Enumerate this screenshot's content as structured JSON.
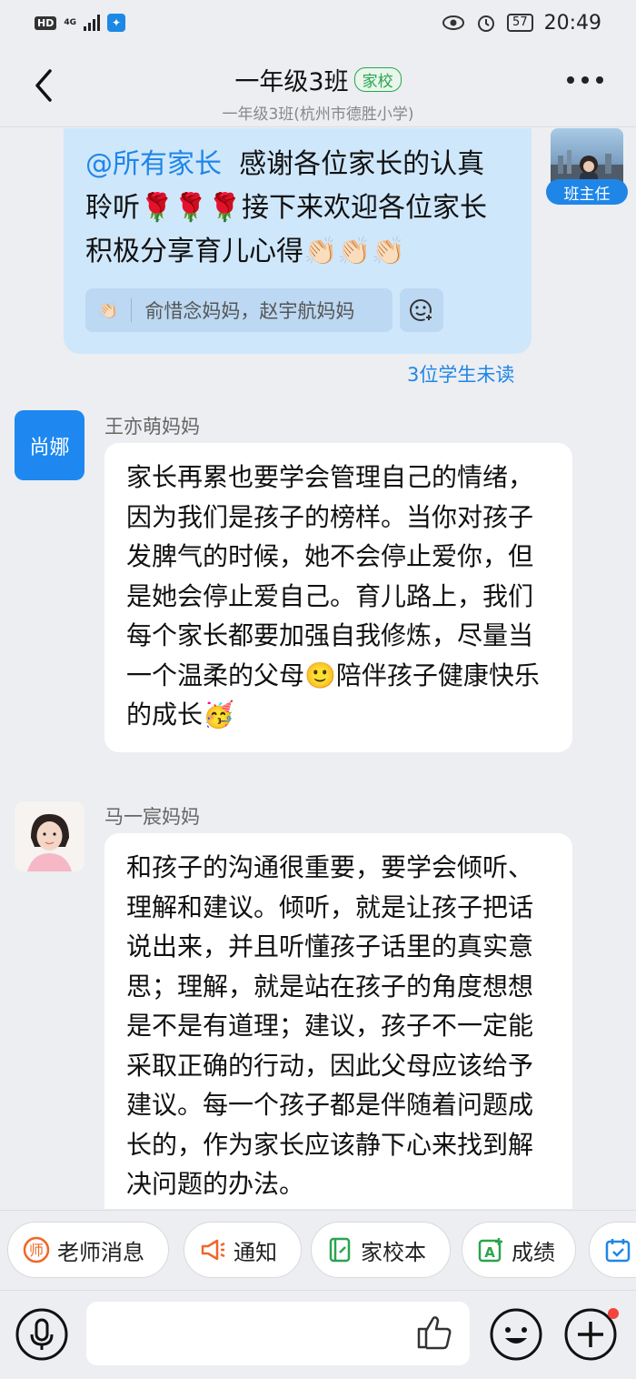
{
  "status_bar": {
    "hd": "HD",
    "network": "4G",
    "battery": "57",
    "time": "20:49"
  },
  "header": {
    "title": "一年级3班",
    "badge": "家校",
    "subtitle": "一年级3班(杭州市德胜小学)"
  },
  "messages": {
    "self": {
      "mention": "@所有家长",
      "text": "感谢各位家长的认真聆听🌹🌹🌹接下来欢迎各位家长积极分享育儿心得👏🏻👏🏻👏🏻",
      "reply_names": "俞惜念妈妈，赵宇航妈妈",
      "unread": "3位学生未读",
      "teacher_tag": "班主任"
    },
    "msg1": {
      "avatar_text": "尚娜",
      "sender": "王亦萌妈妈",
      "text_main": "家长再累也要学会管理自己的情绪，因为我们是孩子的榜样。当你对孩子发脾气的时候，她不会停止爱你，但是她会停止爱自己。育儿路上，我们每个家长都要加强自我修炼，尽量当一个温柔的父母",
      "emoji1": "🙂",
      "text_tail": "陪伴孩子健康快乐的成长",
      "emoji2": "🥳"
    },
    "msg2": {
      "sender": "马一宸妈妈",
      "text": "和孩子的沟通很重要，要学会倾听、理解和建议。倾听，就是让孩子把话说出来，并且听懂孩子话里的真实意思；理解，就是站在孩子的角度想想是不是有道理；建议，孩子不一定能采取正确的行动，因此父母应该给予建议。每一个孩子都是伴随着问题成长的，作为家长应该静下心来找到解决问题的办法。"
    }
  },
  "quick_actions": [
    {
      "label": "老师消息",
      "icon": "teacher-icon",
      "color": "#f0662a"
    },
    {
      "label": "通知",
      "icon": "megaphone-icon",
      "color": "#f0662a"
    },
    {
      "label": "家校本",
      "icon": "notebook-icon",
      "color": "#2aa44f"
    },
    {
      "label": "成绩",
      "icon": "grade-icon",
      "color": "#2aa44f"
    },
    {
      "label": "",
      "icon": "calendar-icon",
      "color": "#1f86e8"
    }
  ],
  "colors": {
    "accent": "#1f86e8",
    "self_bubble": "#cfe7fb",
    "badge_green": "#2aa44f"
  }
}
